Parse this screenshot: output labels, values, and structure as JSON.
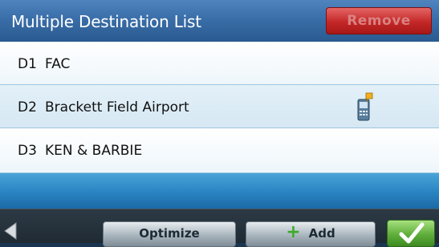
{
  "header": {
    "title": "Multiple Destination List",
    "remove_label": "Remove"
  },
  "destinations": [
    {
      "index": "D1",
      "name": "FAC",
      "icon": null
    },
    {
      "index": "D2",
      "name": "Brackett Field Airport",
      "icon": "phone-icon"
    },
    {
      "index": "D3",
      "name": "KEN & BARBIE",
      "icon": null
    }
  ],
  "toolbar": {
    "back_icon": "back-arrow-icon",
    "optimize_label": "Optimize",
    "add_label": "Add",
    "add_icon": "plus-icon",
    "confirm_icon": "checkmark-icon"
  },
  "colors": {
    "header_blue": "#3a6ea8",
    "remove_red": "#c42727",
    "confirm_green": "#5fae3a",
    "band_blue": "#2b86c4"
  }
}
